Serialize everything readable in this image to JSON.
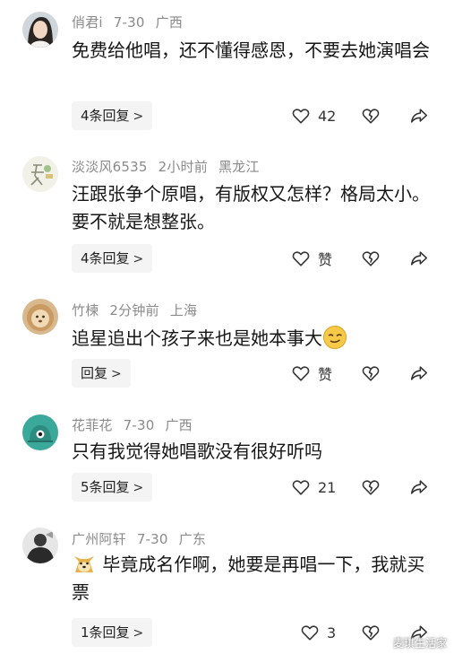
{
  "comments": [
    {
      "user": "俏君i",
      "time": "7-30",
      "location": "广西",
      "text": "免费给他唱，还不懂得感恩，不要去她演唱会",
      "reply": "4条回复",
      "likes": "42",
      "avatar_icon": "woman-portrait-icon"
    },
    {
      "user": "淡淡风6535",
      "time": "2小时前",
      "location": "黑龙江",
      "text": "汪跟张争个原唱，有版权又怎样？格局太小。要不就是想整张。",
      "reply": "4条回复",
      "likes": "赞",
      "avatar_icon": "summer-sketch-icon"
    },
    {
      "user": "竹楝",
      "time": "2分钟前",
      "location": "上海",
      "text": "追星追出个孩子来也是她本事大",
      "reply": "回复",
      "likes": "赞",
      "avatar_icon": "lion-icon"
    },
    {
      "user": "花菲花",
      "time": "7-30",
      "location": "广西",
      "text": "只有我觉得她唱歌没有很好听吗",
      "reply": "5条回复",
      "likes": "21",
      "avatar_icon": "teal-creature-icon"
    },
    {
      "user": "广州阿轩",
      "time": "7-30",
      "location": "广东",
      "text": "毕竟成名作啊，她要是再唱一下，我就买票",
      "reply": "1条回复",
      "likes": "3",
      "avatar_icon": "dark-portrait-icon"
    }
  ],
  "reply_chevron": ">",
  "watermark": "麦琪生活家",
  "colors": {
    "meta": "#8a8a8a",
    "reply_bg": "#f4f4f4",
    "text": "#161616"
  }
}
